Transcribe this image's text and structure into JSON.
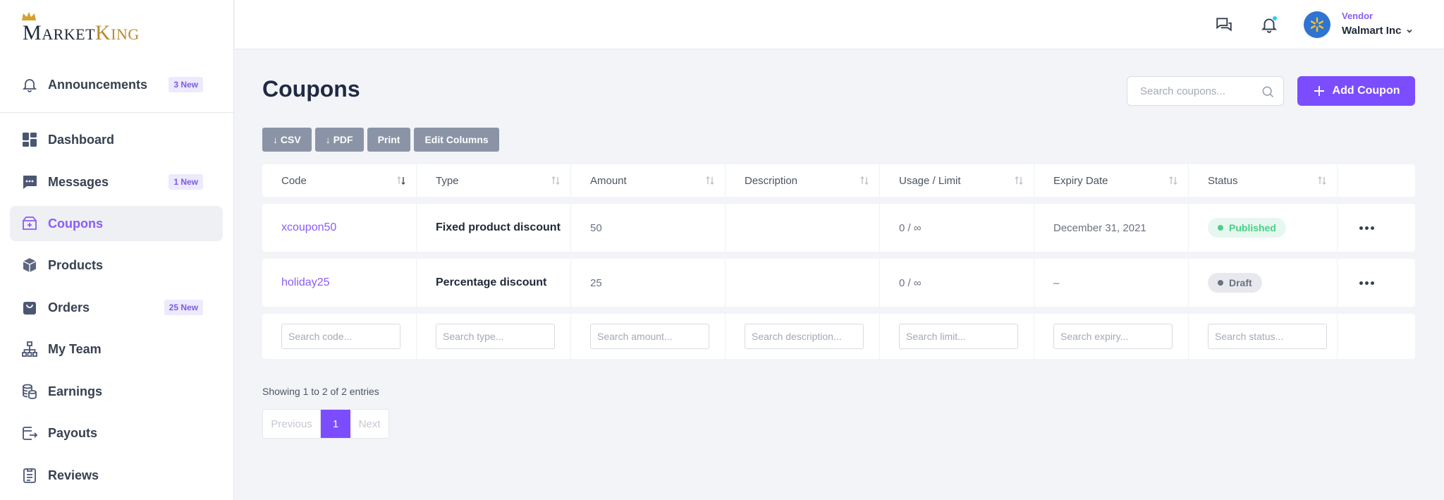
{
  "brand": {
    "name_first": "MARKET",
    "name_second": "KING",
    "m_cap": "M",
    "m_rest": "ARKET",
    "k_cap": "K",
    "k_rest": "ING"
  },
  "sidebar": {
    "items": [
      {
        "label": "Announcements",
        "icon": "bell-icon",
        "badge": "3 New"
      },
      {
        "label": "Dashboard",
        "icon": "dashboard-icon",
        "badge": ""
      },
      {
        "label": "Messages",
        "icon": "chat-icon",
        "badge": "1 New"
      },
      {
        "label": "Coupons",
        "icon": "coupon-icon",
        "badge": "",
        "active": true
      },
      {
        "label": "Products",
        "icon": "box-icon",
        "badge": ""
      },
      {
        "label": "Orders",
        "icon": "bag-icon",
        "badge": "25 New"
      },
      {
        "label": "My Team",
        "icon": "team-icon",
        "badge": ""
      },
      {
        "label": "Earnings",
        "icon": "coins-icon",
        "badge": ""
      },
      {
        "label": "Payouts",
        "icon": "payout-icon",
        "badge": ""
      },
      {
        "label": "Reviews",
        "icon": "review-icon",
        "badge": ""
      }
    ]
  },
  "header": {
    "vendor_role": "Vendor",
    "vendor_name": "Walmart Inc"
  },
  "main": {
    "title": "Coupons",
    "search_placeholder": "Search coupons...",
    "add_label": "Add Coupon",
    "tools": {
      "csv": "↓ CSV",
      "pdf": "↓ PDF",
      "print": "Print",
      "columns": "Edit Columns"
    },
    "columns": [
      "Code",
      "Type",
      "Amount",
      "Description",
      "Usage / Limit",
      "Expiry Date",
      "Status"
    ],
    "rows": [
      {
        "code": "xcoupon50",
        "type": "Fixed product discount",
        "amount": "50",
        "description": "",
        "usage": "0 / ∞",
        "expiry": "December 31, 2021",
        "status": "Published"
      },
      {
        "code": "holiday25",
        "type": "Percentage discount",
        "amount": "25",
        "description": "",
        "usage": "0 / ∞",
        "expiry": "–",
        "status": "Draft"
      }
    ],
    "filters": [
      "Search code...",
      "Search type...",
      "Search amount...",
      "Search description...",
      "Search limit...",
      "Search expiry...",
      "Search status..."
    ],
    "info": "Showing 1 to 2 of 2 entries",
    "pager": {
      "prev": "Previous",
      "current": "1",
      "next": "Next"
    }
  },
  "colors": {
    "accent": "#7c4dff",
    "published": "#4ccd8a",
    "draft": "#6b7280"
  }
}
